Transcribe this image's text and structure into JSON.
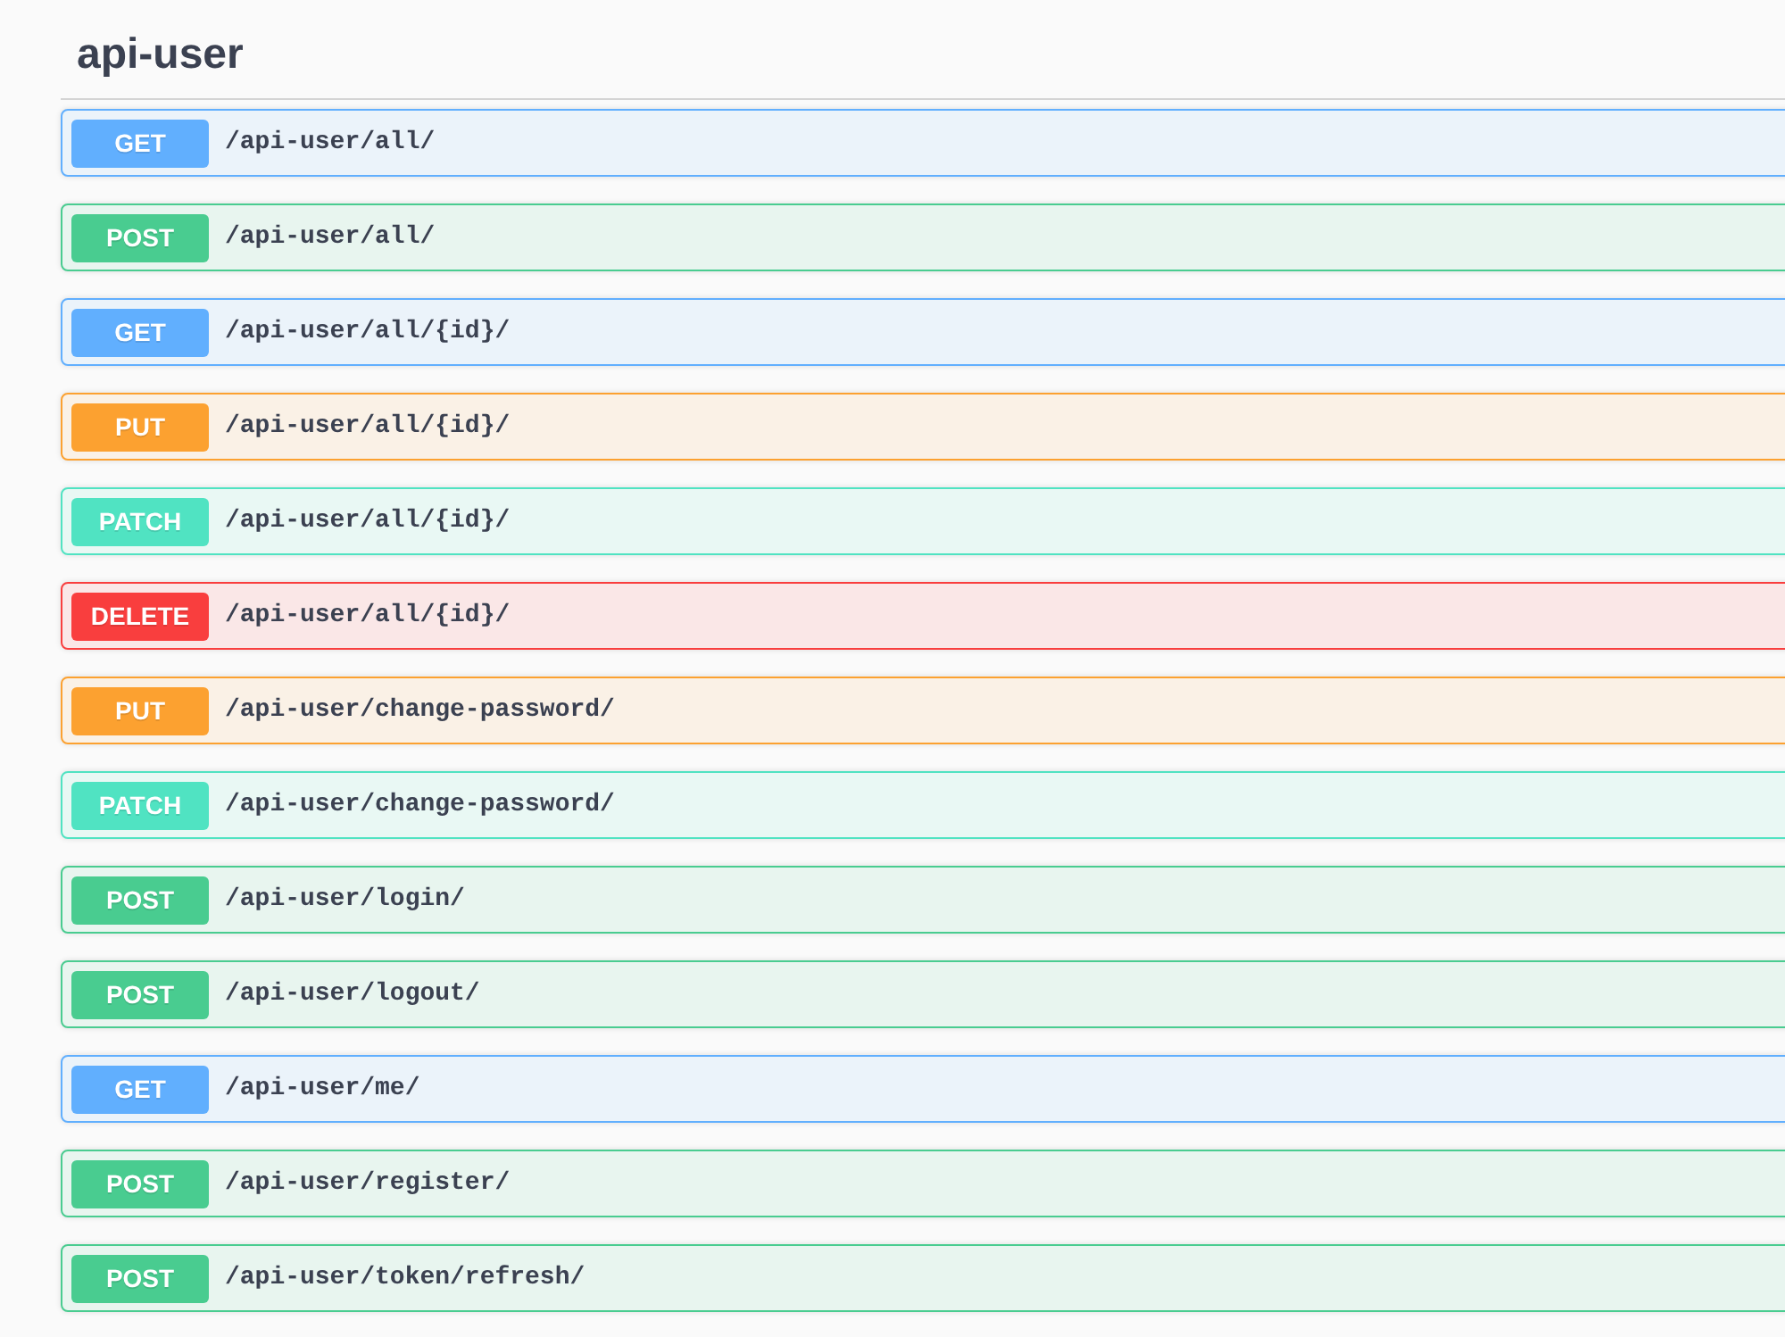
{
  "section": {
    "title": "api-user"
  },
  "endpoints": [
    {
      "method": "GET",
      "path": "/api-user/all/",
      "color": "#61affe"
    },
    {
      "method": "POST",
      "path": "/api-user/all/",
      "color": "#49cc90"
    },
    {
      "method": "GET",
      "path": "/api-user/all/{id}/",
      "color": "#61affe"
    },
    {
      "method": "PUT",
      "path": "/api-user/all/{id}/",
      "color": "#fca130"
    },
    {
      "method": "PATCH",
      "path": "/api-user/all/{id}/",
      "color": "#50e3c2"
    },
    {
      "method": "DELETE",
      "path": "/api-user/all/{id}/",
      "color": "#f93e3e"
    },
    {
      "method": "PUT",
      "path": "/api-user/change-password/",
      "color": "#fca130"
    },
    {
      "method": "PATCH",
      "path": "/api-user/change-password/",
      "color": "#50e3c2"
    },
    {
      "method": "POST",
      "path": "/api-user/login/",
      "color": "#49cc90"
    },
    {
      "method": "POST",
      "path": "/api-user/logout/",
      "color": "#49cc90"
    },
    {
      "method": "GET",
      "path": "/api-user/me/",
      "color": "#61affe"
    },
    {
      "method": "POST",
      "path": "/api-user/register/",
      "color": "#49cc90"
    },
    {
      "method": "POST",
      "path": "/api-user/token/refresh/",
      "color": "#49cc90"
    }
  ]
}
